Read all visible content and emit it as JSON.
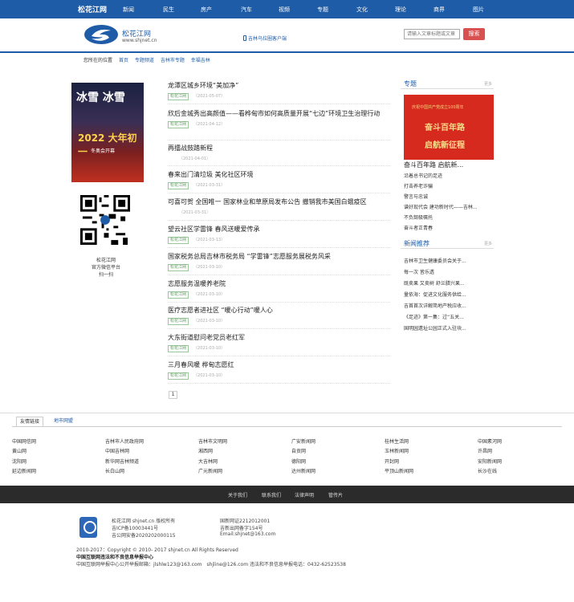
{
  "nav": {
    "brand": "松花江网",
    "items": [
      "新闻",
      "民生",
      "房产",
      "汽车",
      "视频",
      "专题",
      "文化",
      "理论",
      "商界",
      "图片"
    ]
  },
  "header": {
    "logo_name": "松花江网",
    "logo_url": "www.shjnet.cn",
    "mobile_link": "吉林乌拉圈客户端",
    "search_placeholder": "请输入文章标题或文章",
    "search_button": "搜索"
  },
  "breadcrumb": {
    "label": "您所在的位置",
    "items": [
      "首页",
      "专题频道",
      "吉林市专题",
      "幸福吉林"
    ]
  },
  "left": {
    "cover_line1": "冰雪 冰雪",
    "cover_line2": "2022 大年初一",
    "cover_line3": "冬奥会开幕",
    "qr_caption": [
      "松花江网",
      "官方微信平台",
      "扫一扫"
    ]
  },
  "articles": [
    {
      "title": "龙潭区城乡环境“美加净”",
      "tag": "松花江网",
      "date": "（2021-05-07）"
    },
    {
      "title": "欣后金城秀出高颜值——看桦甸市如何高质量开展“七边”环境卫生治理行动",
      "tag": "松花江网",
      "date": "（2021-04-12）"
    },
    {
      "title": "再擂战鼓踏新程",
      "tag": "",
      "date": "（2021-04-01）"
    },
    {
      "title": "春来出门清垃圾 美化社区环境",
      "tag": "松花江网",
      "date": "（2021-03-31）"
    },
    {
      "title": "可喜可贺 全国唯一 国家林业和草原局发布公告 撤销我市美国白蛾疫区",
      "tag": "",
      "date": "（2021-03-31）"
    },
    {
      "title": "望云社区学雷锋 春风送暖爱传承",
      "tag": "松花江网",
      "date": "（2021-03-13）"
    },
    {
      "title": "国家税务总局吉林市税务局 “学雷锋”志愿服务展税务风采",
      "tag": "松花江网",
      "date": "（2021-03-10）"
    },
    {
      "title": "志愿服务温暖养老院",
      "tag": "松花江网",
      "date": "（2021-03-10）"
    },
    {
      "title": "医疗志愿者进社区 “暖心行动”暖人心",
      "tag": "松花江网",
      "date": "（2021-03-10）"
    },
    {
      "title": "大东街道慰问老党员老红军",
      "tag": "松花江网",
      "date": "（2021-03-10）"
    },
    {
      "title": "三月春风暖 桦甸志愿红",
      "tag": "松花江网",
      "date": "（2021-03-10）"
    }
  ],
  "pager": "1",
  "special": {
    "heading": "专题",
    "more": "更多",
    "banner_line1": "庆祝中国共产党成立100周年",
    "banner_line2": "奋斗百年路",
    "banner_line3": "启航新征程",
    "big_title": "奋斗百年路 启航新...",
    "items": [
      "沿着总书记的足迹",
      "打击养老诈骗",
      "警言与忠诚",
      "谱好现代会 建功新时代——吉林...",
      "不负韶极嘱托",
      "奋斗者正青春"
    ]
  },
  "recommend": {
    "heading": "新闻推荐",
    "more": "更多",
    "items": [
      "吉林市卫生健康委员会关于...",
      "每一次 皆乐透",
      "既卖果 又卖树 舒兰腊兴果...",
      "量依海：促进文化服务供给...",
      "吉首首次详解简地产税应收...",
      "《足迹》第一集：过“五关...",
      "国明园遗址公园正式入驻块..."
    ]
  },
  "links": {
    "tabs": [
      "友情链接",
      "地市网盟"
    ],
    "rows": [
      [
        "中国网信网",
        "吉林市人民政府网",
        "吉林市文明网",
        "广安新闻网",
        "桂林生活网",
        "中国素河网"
      ],
      [
        "黄山网",
        "中国吉林网",
        "湘西网",
        "自贡网",
        "玉林新闻网",
        "许昌网"
      ],
      [
        "沈阳网",
        "新华网吉林频道",
        "大吉林网",
        "德阳网",
        "开封网",
        "安阳新闻网"
      ],
      [
        "延边新闻网",
        "长白山网",
        "广元新闻网",
        "达州新闻网",
        "平顶山新闻网",
        "长沙在线"
      ]
    ]
  },
  "footer_nav": [
    "关于我们",
    "联系我们",
    "法律声明",
    "管传片"
  ],
  "footer": {
    "c1": [
      "松花江网 shjnet.cn 版权所有",
      "吉ICP备10003441号",
      "吉公网安备2020202000115"
    ],
    "c2": [
      "国新网证2212012001",
      "吉新出网备字154号",
      "Email:shjnet@163.com"
    ],
    "copyright": "2010-2017：Copyright © 2010- 2017 shjnet.cn All Rights Reserved",
    "report_title": "中国互联网违法和不良信息举报中心",
    "report_line": "中国互联网举报中心公开举报邮箱：jlshlw123@163.com　shjline@126.com 违法和不良信息举报电话：0432-62523538"
  }
}
